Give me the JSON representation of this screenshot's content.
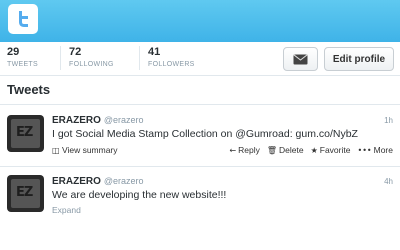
{
  "header": {
    "logo_icon": "twitter-bird-icon",
    "banner_color": "#4fbeee"
  },
  "stats": [
    {
      "count": "29",
      "label": "TWEETS"
    },
    {
      "count": "72",
      "label": "FOLLOWING"
    },
    {
      "count": "41",
      "label": "FOLLOWERS"
    }
  ],
  "profile_actions": {
    "message_icon": "envelope-icon",
    "edit_label": "Edit profile"
  },
  "section": {
    "title": "Tweets"
  },
  "tweets": [
    {
      "name": "ERAZERO",
      "handle": "@erazero",
      "time": "1h",
      "text": "I got Social Media Stamp Collection on @Gumroad: gum.co/NybZ",
      "summary_label": "View summary",
      "actions": {
        "reply": "Reply",
        "delete": "Delete",
        "favorite": "Favorite",
        "more": "More"
      }
    },
    {
      "name": "ERAZERO",
      "handle": "@erazero",
      "time": "4h",
      "text": "We are developing the new website!!!",
      "expand_label": "Expand"
    }
  ]
}
